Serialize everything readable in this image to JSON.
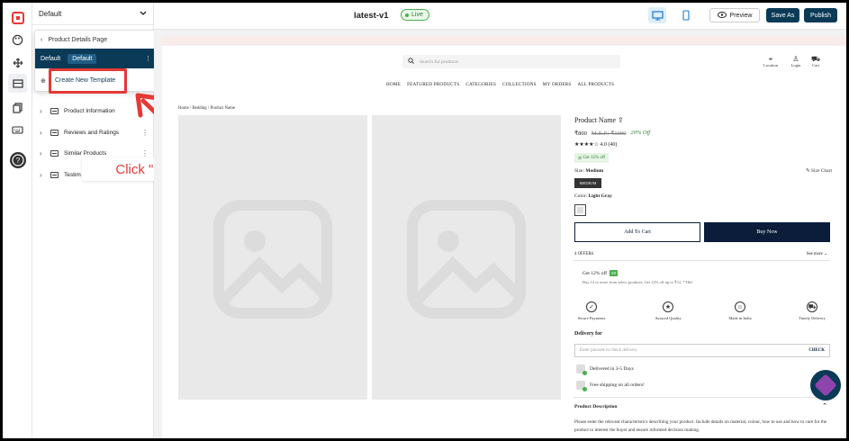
{
  "sidebar": {
    "dropdown_value": "Default",
    "items": [
      {
        "label": "Product Information"
      },
      {
        "label": "Reviews and Ratings"
      },
      {
        "label": "Similar Products"
      },
      {
        "label": "Testim"
      }
    ]
  },
  "popup": {
    "header": "Product Details Page",
    "current_name": "Default",
    "current_chip": "Default",
    "create_label": "Create New Template"
  },
  "annotation": {
    "callout": "Click \"Create New Template\"",
    "color": "#e53935"
  },
  "topbar": {
    "title": "latest-v1",
    "status": "Live",
    "preview_label": "Preview",
    "save_label": "Save As",
    "publish_label": "Publish"
  },
  "store": {
    "search_placeholder": "Search for products",
    "header_icons": [
      "Location",
      "Login",
      "Cart"
    ],
    "nav": [
      "HOME",
      "FEATURED PRODUCTS",
      "CATEGORIES",
      "COLLECTIONS",
      "MY ORDERS",
      "ALL PRODUCTS"
    ],
    "breadcrumb": "Home / Bedding / Product Name",
    "product": {
      "name": "Product Name",
      "price": "₹800",
      "mrp": "M.R.P.: ₹1000",
      "discount": "20% Off",
      "rating": "4.0 (40)",
      "coupon": "Get 12% off",
      "size_label": "Size:",
      "size_value": "Medium",
      "size_chart": "Size Chart",
      "size_option": "MEDIUM",
      "color_label": "Color:",
      "color_value": "Light Gray",
      "add_to_cart": "Add To Cart",
      "buy_now": "Buy Now",
      "offers_count": "4 OFFERS",
      "see_more": "See more",
      "offer_title": "Get 12% off",
      "offer_tag": "SB",
      "offer_desc": "Buy 12 or more from select products, Get 12% off up to ₹12. *T&C",
      "features": [
        "Secure Payments",
        "Assured Quality",
        "Made in India",
        "Timely Delivery"
      ],
      "delivery_for": "Delivery for",
      "pincode_placeholder": "Enter pincode to check delivery",
      "check_label": "CHECK",
      "delivery_lines": [
        "Delivered in 3-5 Days",
        "Free shipping on all orders!"
      ],
      "desc_title": "Product Description",
      "desc_text": "Please enter the relevant characteristics describing your product. Include details on material, colour, how to use and how to care for the product to interest the buyer and ensure informed decision making."
    }
  }
}
